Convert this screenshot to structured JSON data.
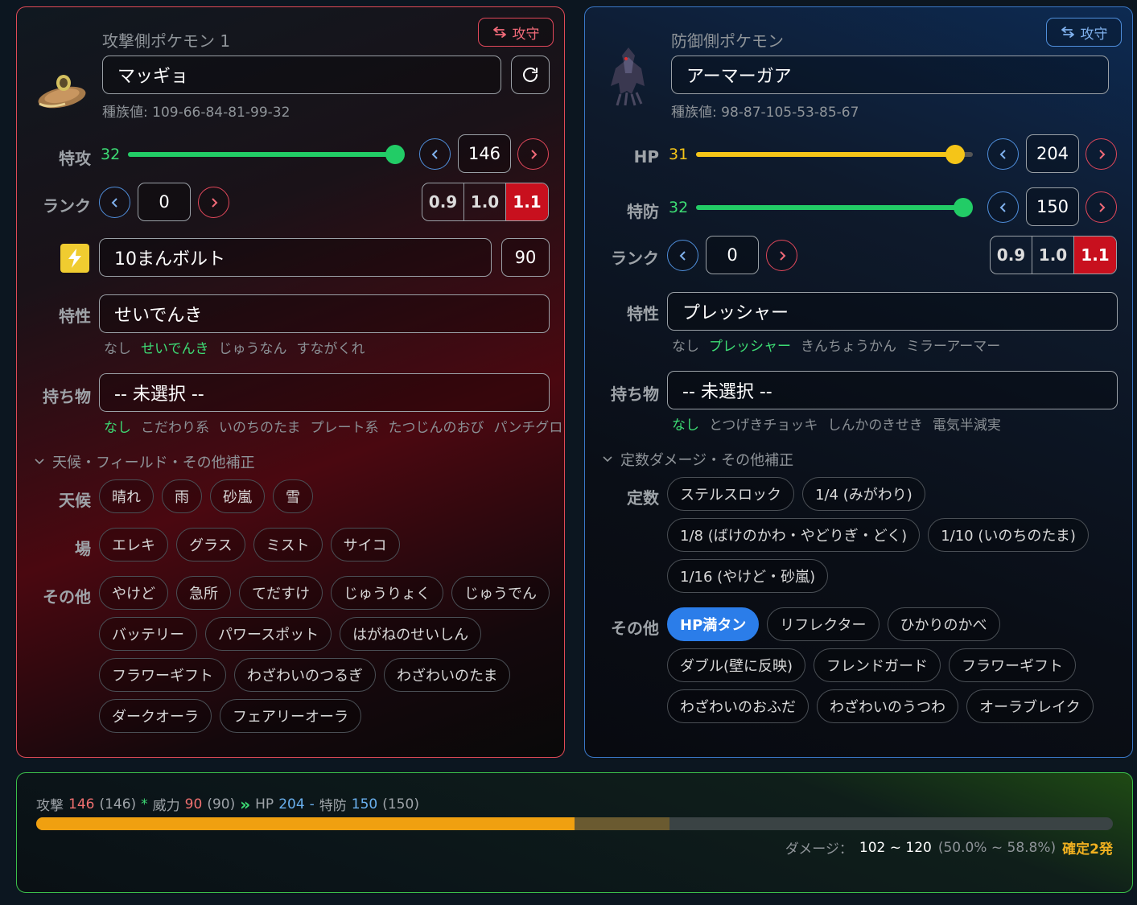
{
  "attacker": {
    "title": "攻撃側ポケモン 1",
    "swap_label": "攻守",
    "name": "マッギョ",
    "base_stats": "種族値: 109-66-84-81-99-32",
    "stat_label": "特攻",
    "iv": "32",
    "stat_value": "146",
    "rank_label": "ランク",
    "rank_value": "0",
    "nature": [
      "0.9",
      "1.0",
      "1.1"
    ],
    "nature_selected": "1.1",
    "move": "10まんボルト",
    "move_power": "90",
    "move_type_icon": "electric-type-icon",
    "ability_label": "特性",
    "ability": "せいでんき",
    "ability_options": [
      "なし",
      "せいでんき",
      "じゅうなん",
      "すながくれ"
    ],
    "item_label": "持ち物",
    "item": "-- 未選択 --",
    "item_options": [
      "なし",
      "こだわり系",
      "いのちのたま",
      "プレート系",
      "たつじんのおび",
      "パンチグロ"
    ],
    "section_title": "天候・フィールド・その他補正",
    "weather_label": "天候",
    "weather": [
      "晴れ",
      "雨",
      "砂嵐",
      "雪"
    ],
    "field_label": "場",
    "field": [
      "エレキ",
      "グラス",
      "ミスト",
      "サイコ"
    ],
    "other_label": "その他",
    "other": [
      "やけど",
      "急所",
      "てだすけ",
      "じゅうりょく",
      "じゅうでん",
      "バッテリー",
      "パワースポット",
      "はがねのせいしん",
      "フラワーギフト",
      "わざわいのつるぎ",
      "わざわいのたま",
      "ダークオーラ",
      "フェアリーオーラ"
    ]
  },
  "defender": {
    "title": "防御側ポケモン",
    "swap_label": "攻守",
    "name": "アーマーガア",
    "base_stats": "種族値: 98-87-105-53-85-67",
    "hp_label": "HP",
    "hp_iv": "31",
    "hp_value": "204",
    "stat_label": "特防",
    "iv": "32",
    "stat_value": "150",
    "rank_label": "ランク",
    "rank_value": "0",
    "nature": [
      "0.9",
      "1.0",
      "1.1"
    ],
    "nature_selected": "1.1",
    "ability_label": "特性",
    "ability": "プレッシャー",
    "ability_options": [
      "なし",
      "プレッシャー",
      "きんちょうかん",
      "ミラーアーマー"
    ],
    "item_label": "持ち物",
    "item": "-- 未選択 --",
    "item_options": [
      "なし",
      "とつげきチョッキ",
      "しんかのきせき",
      "電気半減実"
    ],
    "section_title": "定数ダメージ・その他補正",
    "fixed_label": "定数",
    "fixed": [
      "ステルスロック",
      "1/4 (みがわり)",
      "1/8 (ばけのかわ・やどりぎ・どく)",
      "1/10 (いのちのたま)",
      "1/16 (やけど・砂嵐)"
    ],
    "other_label": "その他",
    "other": [
      "HP満タン",
      "リフレクター",
      "ひかりのかべ",
      "ダブル(壁に反映)",
      "フレンドガード",
      "フラワーギフト",
      "わざわいのおふだ",
      "わざわいのうつわ",
      "オーラブレイク"
    ],
    "other_selected": "HP満タン"
  },
  "result": {
    "atk_label": "攻撃",
    "atk_value": "146",
    "atk_raw": "(146)",
    "times": "*",
    "power_label": "威力",
    "power_value": "90",
    "power_raw": "(90)",
    "arrow": "»",
    "hp_label": "HP",
    "hp_value": "204",
    "dash": "-",
    "def_label": "特防",
    "def_value": "150",
    "def_raw": "(150)",
    "bar_min_pct": 50.0,
    "bar_max_pct": 58.8,
    "damage_label": "ダメージ：",
    "damage_range": "102 ~ 120",
    "damage_pct": "(50.0% ~ 58.8%)",
    "ko_text": "確定2発"
  },
  "colors": {
    "attacker_border": "#e04a56",
    "defender_border": "#3a78c8",
    "result_border": "#3bbf4a",
    "slider_green": "#22cc66",
    "slider_yellow": "#f5c518",
    "selected_red": "#c8101e",
    "selected_blue": "#2b7de9",
    "bar_orange": "#f0a010"
  }
}
